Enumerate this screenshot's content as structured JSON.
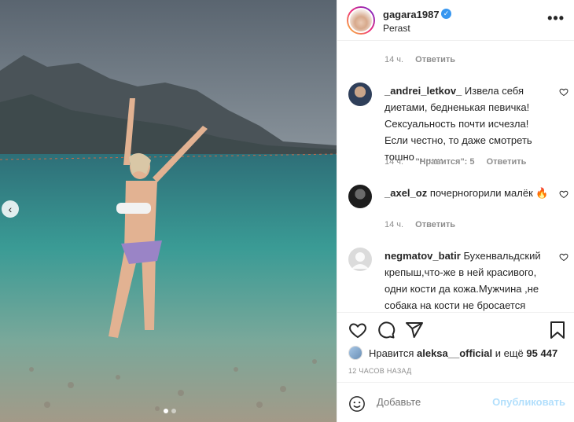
{
  "post": {
    "username": "gagara1987",
    "location": "Perast",
    "more_label": "•••",
    "carousel_prev": "‹"
  },
  "comments": {
    "first_meta": {
      "time": "14 ч.",
      "reply": "Ответить"
    },
    "items": [
      {
        "username": "_andrei_letkov_",
        "text": "Извела себя диетами, бедненькая певичка! Сексуальность почти исчезла! Если честно, то даже смотреть тошно .........",
        "time": "14 ч.",
        "likes": "\"Нравится\": 5",
        "reply": "Ответить"
      },
      {
        "username": "_axel_oz",
        "text": "почерногорили малёк 🔥",
        "time": "14 ч.",
        "reply": "Ответить"
      },
      {
        "username": "negmatov_batir",
        "text": "Бухенвальдский крепыш,что-же в ней красивого, одни кости да кожа.Мужчина ,не собака на кости не бросается"
      }
    ]
  },
  "likes": {
    "prefix": "Нравится",
    "user": "aleksa__official",
    "middle": "и ещё",
    "count": "95 447"
  },
  "timestamp": "12 ЧАСОВ НАЗАД",
  "add_comment": {
    "placeholder": "Добавьте",
    "post_label": "Опубликовать"
  },
  "colors": {
    "verified": "#3897f0",
    "post_button_disabled": "#b2dffc",
    "meta_text": "#8e8e8e"
  },
  "icons": [
    "heart-icon",
    "comment-icon",
    "share-icon",
    "bookmark-icon",
    "emoji-icon",
    "verified-icon",
    "more-icon"
  ]
}
